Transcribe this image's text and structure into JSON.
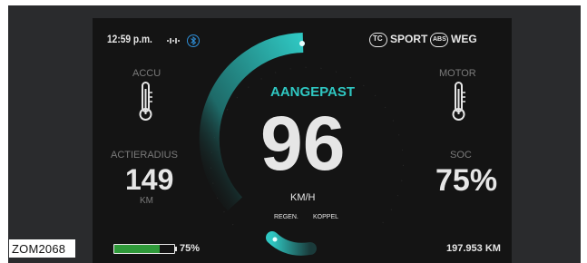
{
  "figure_label": "ZOM2068",
  "status_bar": {
    "time": "12:59 p.m.",
    "signal_icon": "signal-dots-icon",
    "bluetooth_icon": "bluetooth-icon",
    "traction_badge": "TC",
    "mode_label": "SPORT",
    "abs_badge": "ABS",
    "road_label": "WEG"
  },
  "left_panel": {
    "battery_temp_label": "ACCU",
    "range_label": "ACTIERADIUS",
    "range_value": "149",
    "range_unit": "KM"
  },
  "center": {
    "mode_title": "AANGEPAST",
    "speed_value": "96",
    "speed_unit": "KM/H",
    "regen_label": "REGEN.",
    "torque_label": "KOPPEL"
  },
  "right_panel": {
    "motor_temp_label": "MOTOR",
    "soc_label": "SOC",
    "soc_value": "75%"
  },
  "bottom_bar": {
    "battery_level_percent": 75,
    "battery_text": "75%",
    "odometer": "197.953 KM"
  },
  "colors": {
    "accent_teal": "#2fc7c2",
    "battery_green": "#2f9a3a",
    "screen_bg": "#141414"
  }
}
